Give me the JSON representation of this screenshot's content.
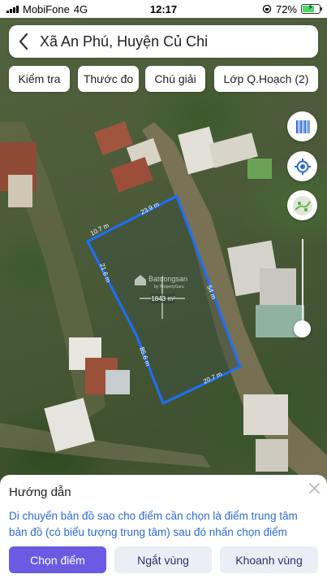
{
  "status_bar": {
    "carrier": "MobiFone",
    "network": "4G",
    "time": "12:17",
    "battery": "72%",
    "battery_level": 0.72
  },
  "header": {
    "title": "Xã An Phú, Huyện Củ Chi",
    "back_icon": "chevron-left-icon"
  },
  "toolbar": {
    "buttons": [
      {
        "label": "Kiểm tra"
      },
      {
        "label": "Thước đo"
      },
      {
        "label": "Chú giải"
      },
      {
        "label": "Lớp Q.Hoạch (2)"
      }
    ]
  },
  "map": {
    "parcel": {
      "area": "1843 m²",
      "edges": [
        "23.9 m",
        "54 m",
        "20.7 m",
        "85.6 m",
        "21.6 m",
        "10.7 m"
      ],
      "outline_color": "#1f6fff"
    },
    "watermark": {
      "brand": "Batdongsan",
      "sub": "by PropertyGuru"
    }
  },
  "controls": {
    "barcode_icon": "barcode-icon",
    "locate_icon": "locate-icon",
    "layer_icon": "map-layer-icon",
    "accent": "#2d6ad7"
  },
  "sheet": {
    "title": "Hướng dẫn",
    "description": "Di chuyển bản đồ sao cho điểm cần chọn là điểm trung tâm bản đồ (có biểu tượng trung tâm) sau đó nhấn chọn điểm",
    "buttons": {
      "primary": "Chọn điểm",
      "split": "Ngắt vùng",
      "zone": "Khoanh vùng"
    },
    "primary_color": "#6a5be2"
  }
}
